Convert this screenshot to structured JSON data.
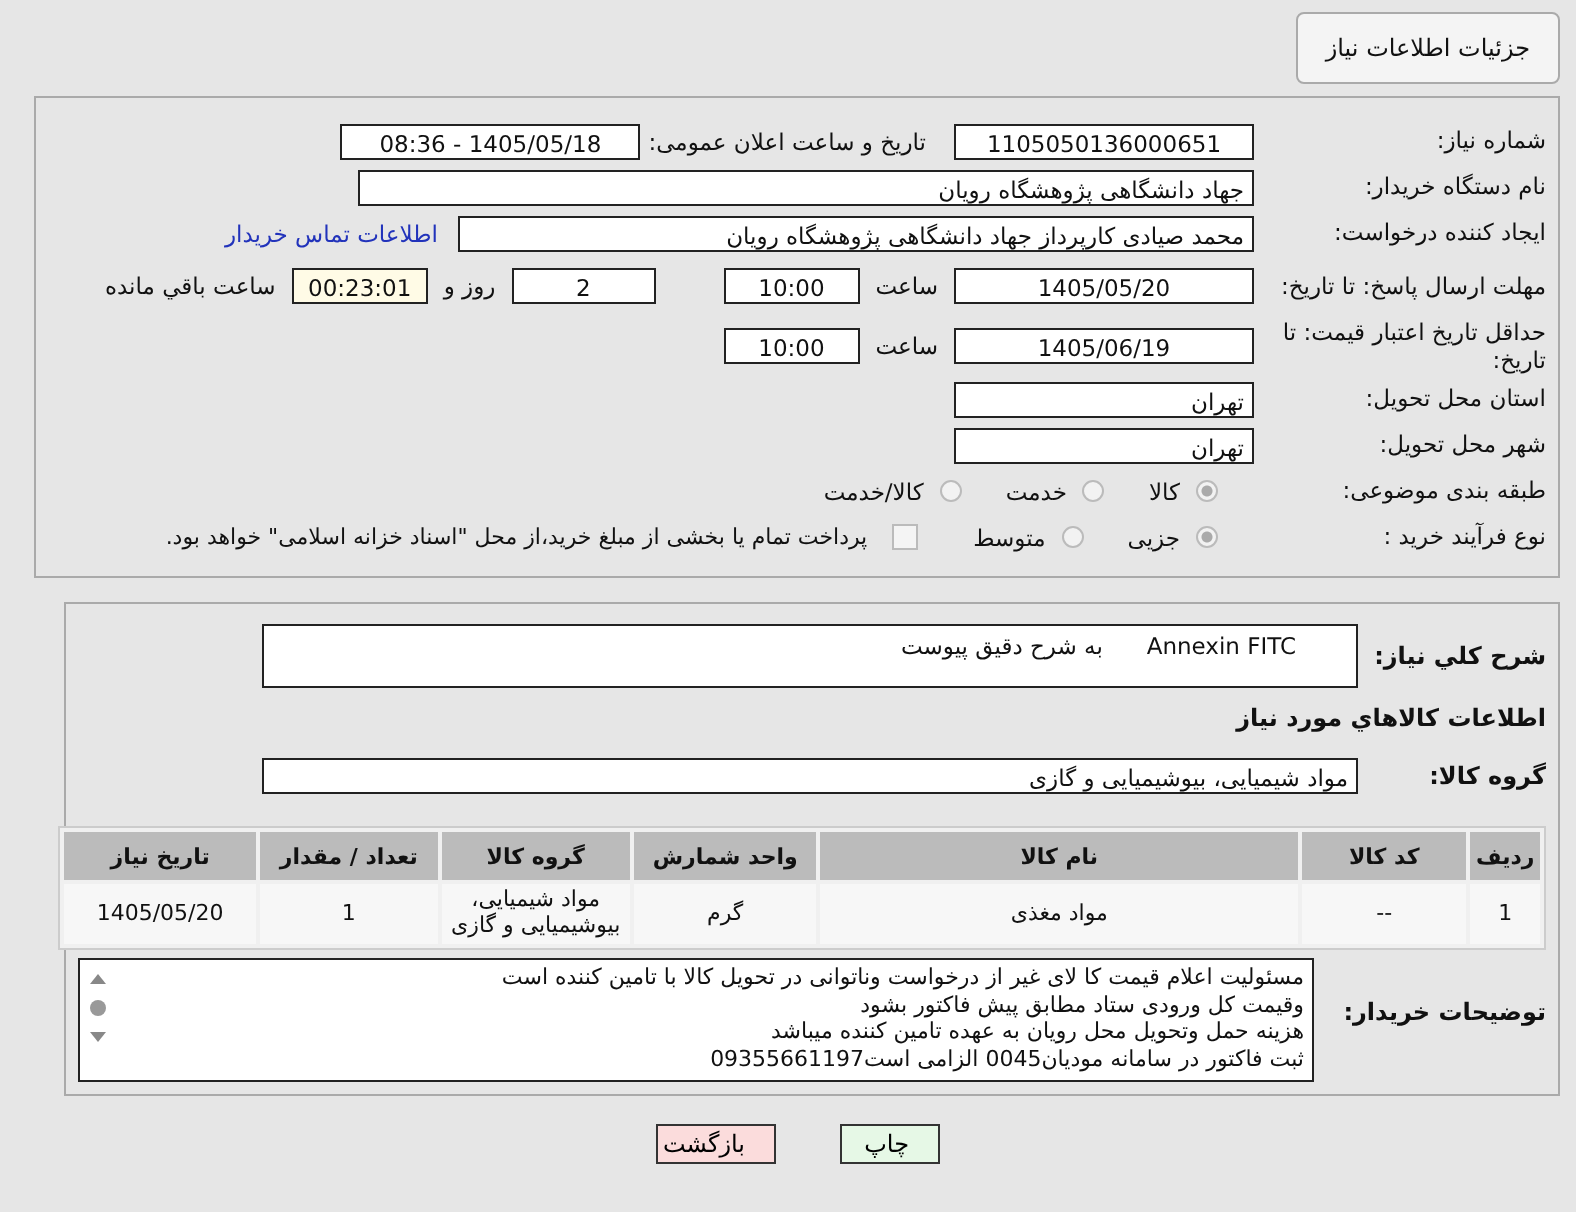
{
  "title": "جزئیات اطلاعات نیاز",
  "need_number": {
    "label": "شماره نیاز:",
    "value": "1105050136000651"
  },
  "announce": {
    "label": "تاریخ و ساعت اعلان عمومی:",
    "value": "1405/05/18 - 08:36"
  },
  "buyer_org": {
    "label": "نام دستگاه خریدار:",
    "value": "جهاد دانشگاهی پژوهشگاه رویان"
  },
  "requester": {
    "label": "ایجاد کننده درخواست:",
    "value": "محمد صیادی کارپرداز جهاد دانشگاهی پژوهشگاه رویان",
    "link": "اطلاعات تماس خریدار"
  },
  "deadline": {
    "label": "مهلت ارسال پاسخ: تا تاریخ:",
    "date": "1405/05/20",
    "time_label": "ساعت",
    "time": "10:00",
    "days": "2",
    "days_label": "روز و",
    "remaining": "00:23:01",
    "remaining_label": "ساعت باقي مانده"
  },
  "validity": {
    "label": "حداقل تاریخ اعتبار قیمت: تا تاریخ:",
    "date": "1405/06/19",
    "time_label": "ساعت",
    "time": "10:00"
  },
  "province": {
    "label": "استان محل تحویل:",
    "value": "تهران"
  },
  "city": {
    "label": "شهر محل تحویل:",
    "value": "تهران"
  },
  "category": {
    "label": "طبقه بندی موضوعی:",
    "options": [
      {
        "label": "کالا",
        "selected": true
      },
      {
        "label": "خدمت",
        "selected": false
      },
      {
        "label": "کالا/خدمت",
        "selected": false
      }
    ]
  },
  "process": {
    "label": "نوع فرآیند خرید :",
    "options": [
      {
        "label": "جزیی",
        "selected": true
      },
      {
        "label": "متوسط",
        "selected": false
      }
    ],
    "payment": {
      "label": "پرداخت تمام یا بخشی از مبلغ خرید،از محل \"اسناد خزانه اسلامی\" خواهد بود.",
      "checked": false
    }
  },
  "description": {
    "label": "شرح کلي نياز:",
    "value": "Annexin FITC      به شرح دقیق پیوست"
  },
  "goods_heading": "اطلاعات کالاهاي مورد نياز",
  "goods_group": {
    "label": "گروه کالا:",
    "value": "مواد شیمیایی، بیوشیمیایی و  گازی"
  },
  "table": {
    "columns": [
      "ردیف",
      "کد کالا",
      "نام کالا",
      "واحد شمارش",
      "گروه کالا",
      "تعداد / مقدار",
      "تاریخ نیاز"
    ],
    "rows": [
      [
        "1",
        "--",
        "مواد مغذی",
        "گرم",
        "مواد شیمیایی، بیوشیمیایی و گازی",
        "1",
        "1405/05/20"
      ]
    ]
  },
  "buyer_notes": {
    "label": "توضیحات خریدار:",
    "lines": [
      "مسئولیت اعلام قیمت کا لای  غیر از درخواست وناتوانی در تحویل کالا با تامین کننده است",
      "وقیمت کل ورودی ستاد مطابق پیش فاکتور بشود",
      "هزینه حمل وتحویل محل رویان به عهده تامین کننده میباشد",
      "ثبت فاکتور در سامانه مودیان0045 الزامی است09355661197"
    ]
  },
  "buttons": [
    {
      "label": "چاپ",
      "kind": "print"
    },
    {
      "label": "بازگشت",
      "kind": "back"
    }
  ]
}
